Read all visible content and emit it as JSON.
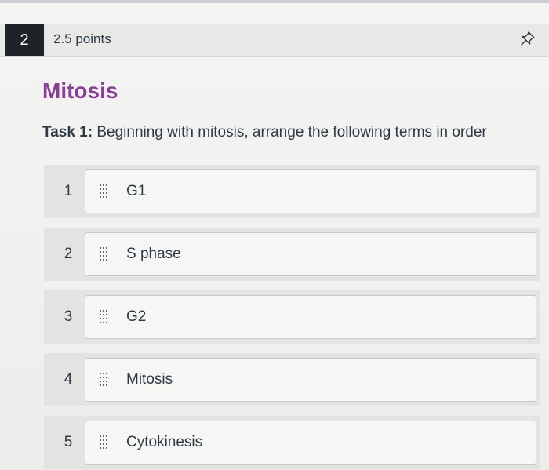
{
  "question": {
    "number": "2",
    "points": "2.5 points",
    "title": "Mitosis",
    "task_label": "Task 1:",
    "task_text": " Beginning with mitosis, arrange the following terms in order"
  },
  "icons": {
    "pin": "pin-icon",
    "grip": "drag-handle-icon"
  },
  "order_list": [
    {
      "position": "1",
      "term": "G1"
    },
    {
      "position": "2",
      "term": "S phase"
    },
    {
      "position": "3",
      "term": "G2"
    },
    {
      "position": "4",
      "term": "Mitosis"
    },
    {
      "position": "5",
      "term": "Cytokinesis"
    }
  ],
  "colors": {
    "title": "#8a3e97",
    "number_badge": "#1f2226"
  }
}
